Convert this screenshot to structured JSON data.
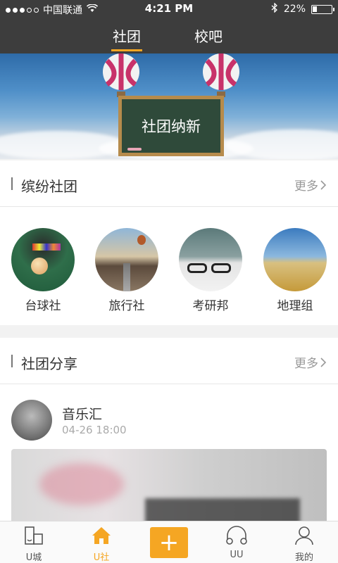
{
  "status_bar": {
    "carrier": "中国联通",
    "time": "4:21 PM",
    "battery": "22%"
  },
  "top_tabs": [
    {
      "label": "社团"
    },
    {
      "label": "校吧"
    }
  ],
  "banner": {
    "board_text": "社团纳新"
  },
  "section_clubs": {
    "title": "缤纷社团",
    "more_label": "更多",
    "items": [
      {
        "name": "台球社"
      },
      {
        "name": "旅行社"
      },
      {
        "name": "考研邦"
      },
      {
        "name": "地理组"
      }
    ]
  },
  "section_share": {
    "title": "社团分享",
    "more_label": "更多",
    "post": {
      "author": "音乐汇",
      "time": "04-26 18:00"
    }
  },
  "bottom_nav": {
    "items": [
      {
        "label": "U城"
      },
      {
        "label": "U社"
      },
      {
        "label": "UU"
      },
      {
        "label": "我的"
      }
    ]
  },
  "colors": {
    "accent": "#f5a623",
    "header_bg": "#3d3d3d"
  }
}
